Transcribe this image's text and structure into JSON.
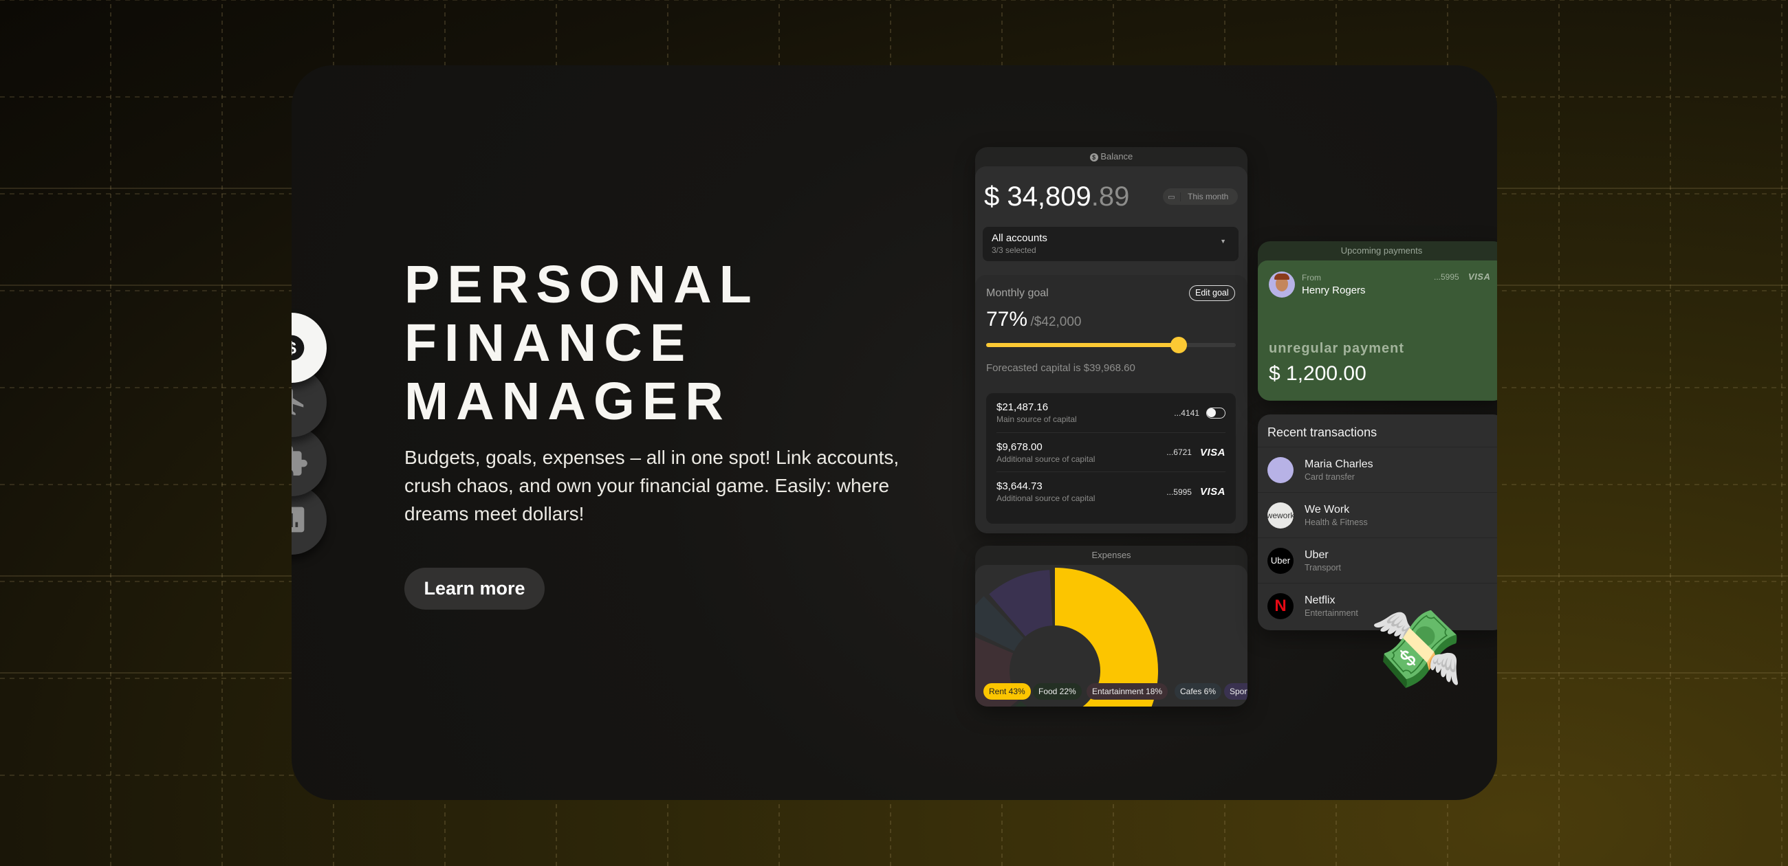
{
  "hero": {
    "title_lines": [
      "PERSONAL",
      "FINANCE",
      "MANAGER"
    ],
    "description": "Budgets, goals, expenses – all in one spot! Link accounts, crush chaos, and own your financial game. Easily: where dreams meet dollars!",
    "cta": "Learn more"
  },
  "nav": [
    {
      "icon": "dollar-icon",
      "active": true
    },
    {
      "icon": "airplane-icon"
    },
    {
      "icon": "puzzle-icon"
    },
    {
      "icon": "bar-chart-icon"
    }
  ],
  "balance": {
    "caption": "Balance",
    "amount_main": "$ 34,809",
    "amount_cents": ".89",
    "period": "This month",
    "accounts_label": "All accounts",
    "accounts_sub": "3/3 selected",
    "goal_label": "Monthly goal",
    "edit_goal": "Edit goal",
    "goal_percent": "77%",
    "goal_target": "/$42,000",
    "goal_progress": 77,
    "forecast": "Forecasted capital is $39,968.60",
    "sources": [
      {
        "amount": "$21,487.16",
        "label": "Main source of capital",
        "card": "...4141",
        "brand": "toggle"
      },
      {
        "amount": "$9,678.00",
        "label": "Additional source of capital",
        "card": "...6721",
        "brand": "VISA"
      },
      {
        "amount": "$3,644.73",
        "label": "Additional source of capital",
        "card": "...5995",
        "brand": "VISA"
      }
    ]
  },
  "expenses": {
    "caption": "Expenses"
  },
  "chart_data": {
    "type": "pie",
    "title": "Expenses",
    "categories": [
      "Rent",
      "Food",
      "Entartainment",
      "Cafes",
      "Sport"
    ],
    "labels": [
      "Rent 43%",
      "Food 22%",
      "Entartainment 18%",
      "Cafes 6%",
      "Sport"
    ],
    "values": [
      43,
      22,
      18,
      6,
      null
    ],
    "colors": [
      "#fcc500",
      "#27352a",
      "#3f3034",
      "#2f363b",
      "#3a3250"
    ],
    "legend": "bottom"
  },
  "upcoming": {
    "caption": "Upcoming payments",
    "from_label": "From",
    "name": "Henry Rogers",
    "card": "...5995",
    "brand": "VISA",
    "type": "unregular payment",
    "amount": "$ 1,200.00",
    "color": "#3b5a36"
  },
  "transactions": {
    "title": "Recent transactions",
    "items": [
      {
        "name": "Maria Charles",
        "sub": "Card transfer",
        "logo": ""
      },
      {
        "name": "We Work",
        "sub": "Health & Fitness",
        "logo": "wework"
      },
      {
        "name": "Uber",
        "sub": "Transport",
        "logo": "Uber"
      },
      {
        "name": "Netflix",
        "sub": "Entertainment",
        "logo": "N"
      }
    ]
  }
}
